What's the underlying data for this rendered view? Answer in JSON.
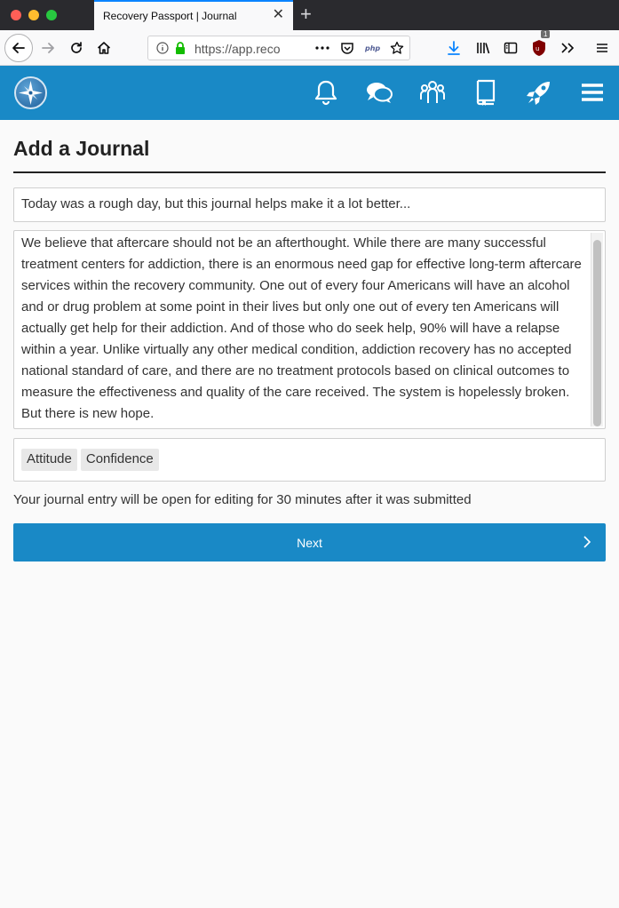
{
  "browser": {
    "tab_title": "Recovery Passport | Journal",
    "tab_close": "✕",
    "new_tab": "+",
    "url": "https://app.recoverypassport.org/journal",
    "url_display": "https://app.reco",
    "extension_badge": "1",
    "icons": [
      "back-icon",
      "forward-icon",
      "reload-icon",
      "home-icon",
      "info-icon",
      "lock-icon",
      "more-icon",
      "pocket-icon",
      "php-icon",
      "star-icon",
      "download-icon",
      "library-icon",
      "sidebar-icon",
      "ublock-icon",
      "overflow-icon",
      "menu-icon"
    ]
  },
  "app": {
    "brand_color": "#1989c6",
    "header_icons": [
      "compass-logo-icon",
      "bell-icon",
      "chat-icon",
      "community-icon",
      "journal-book-icon",
      "rocket-icon",
      "hamburger-menu-icon"
    ]
  },
  "page": {
    "title": "Add a Journal",
    "subject_value": "Today was a rough day, but this journal helps make it a lot better...",
    "body_value": "We believe that aftercare should not be an afterthought. While there are many successful treatment centers for addiction, there is an enormous need gap for effective long-term aftercare services within the recovery community.  One out of every four Americans will have an alcohol and or drug problem at some point in their lives but only one out of every ten Americans will actually get help for their addiction. And of those who do seek help, 90% will have a relapse within a year. Unlike virtually any other medical condition, addiction recovery has no accepted national standard of care, and there are no treatment protocols based on clinical outcomes to measure the effectiveness and quality of the care received. The system is hopelessly broken. But there is new hope.",
    "tags": [
      "Attitude",
      "Confidence"
    ],
    "edit_note": "Your journal entry will be open for editing for 30 minutes after it was submitted",
    "next_label": "Next"
  }
}
